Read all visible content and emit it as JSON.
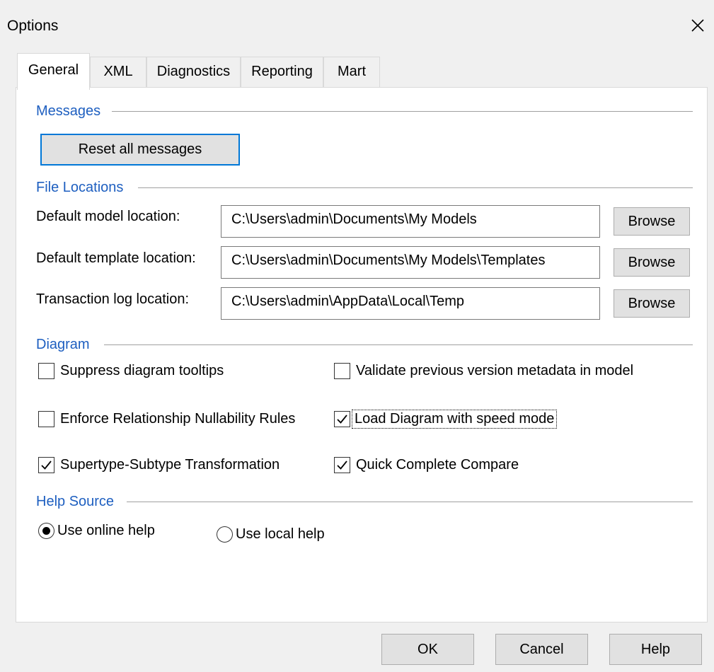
{
  "window": {
    "title": "Options"
  },
  "tabs": [
    {
      "label": "General",
      "active": true
    },
    {
      "label": "XML",
      "active": false
    },
    {
      "label": "Diagnostics",
      "active": false
    },
    {
      "label": "Reporting",
      "active": false
    },
    {
      "label": "Mart",
      "active": false
    }
  ],
  "messages": {
    "group_title": "Messages",
    "reset_button": "Reset all messages"
  },
  "file_locations": {
    "group_title": "File Locations",
    "rows": [
      {
        "label": "Default model location:",
        "value": "C:\\Users\\admin\\Documents\\My Models",
        "browse": "Browse"
      },
      {
        "label": "Default template location:",
        "value": "C:\\Users\\admin\\Documents\\My Models\\Templates",
        "browse": "Browse"
      },
      {
        "label": "Transaction log location:",
        "value": "C:\\Users\\admin\\AppData\\Local\\Temp",
        "browse": "Browse"
      }
    ]
  },
  "diagram": {
    "group_title": "Diagram",
    "options": [
      {
        "label": "Suppress diagram tooltips",
        "checked": false
      },
      {
        "label": "Validate previous version metadata in model",
        "checked": false
      },
      {
        "label": "Enforce Relationship Nullability Rules",
        "checked": false
      },
      {
        "label": "Load Diagram with speed mode",
        "checked": true
      },
      {
        "label": "Supertype-Subtype Transformation",
        "checked": true
      },
      {
        "label": "Quick Complete Compare",
        "checked": true
      }
    ]
  },
  "help_source": {
    "group_title": "Help Source",
    "online_label": "Use online help",
    "local_label": "Use local help",
    "selected": "online"
  },
  "footer": {
    "ok_label": "OK",
    "cancel_label": "Cancel",
    "help_label": "Help"
  },
  "colors": {
    "group_title": "#1e5fc0",
    "focus_border": "#0078d7"
  }
}
